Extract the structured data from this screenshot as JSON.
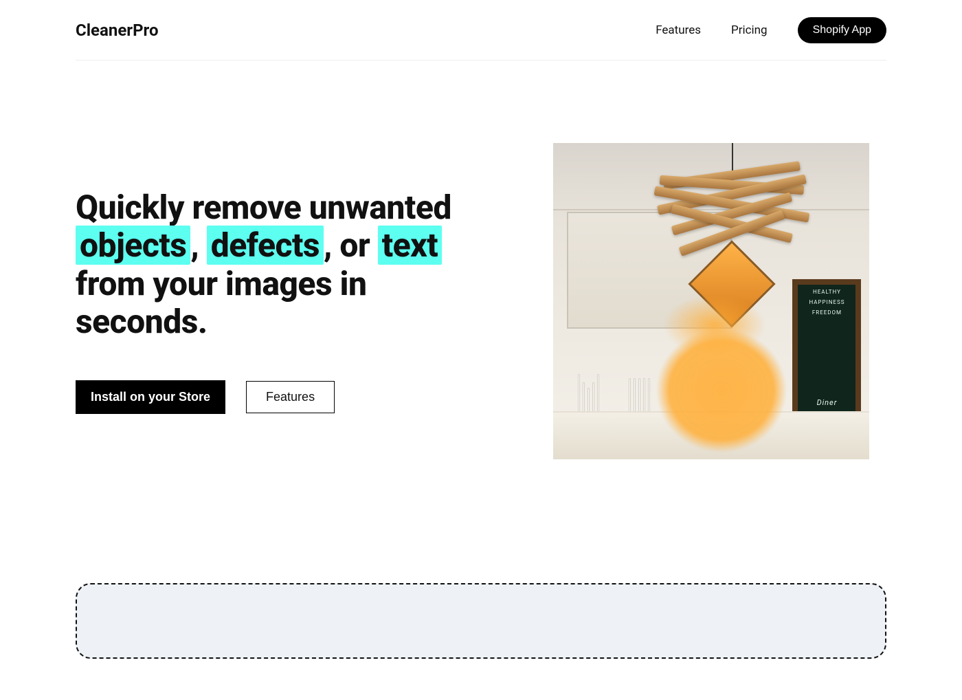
{
  "header": {
    "brand": "CleanerPro",
    "nav": {
      "features": "Features",
      "pricing": "Pricing",
      "cta": "Shopify App"
    }
  },
  "hero": {
    "headline_lead": "Quickly remove unwanted ",
    "hl1": "objects",
    "sep1": ", ",
    "hl2": "defects",
    "sep2": ", or ",
    "hl3": "text",
    "headline_tail": " from your images in seconds.",
    "cta_primary": "Install on your Store",
    "cta_secondary": "Features"
  },
  "chalkboard": {
    "line1": "HEALTHY",
    "line2": "HAPPINESS",
    "line3": "FREEDOM",
    "line4": "Diner"
  },
  "colors": {
    "highlight": "#5dfff0",
    "blob": "#ffae37",
    "button_bg": "#000000"
  }
}
